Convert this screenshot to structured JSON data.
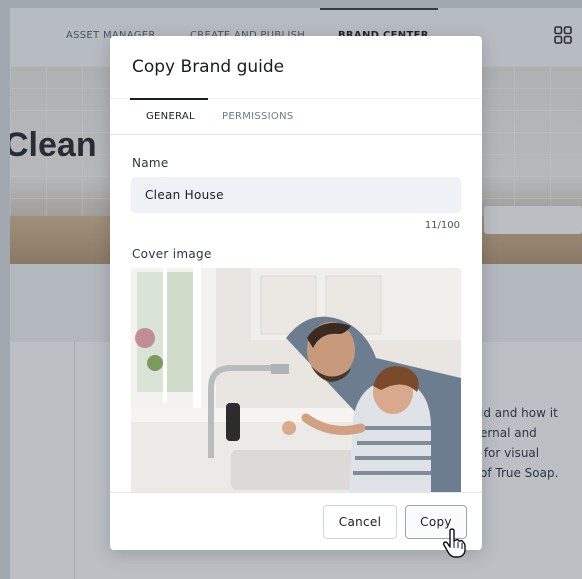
{
  "nav": {
    "items": [
      "ASSET MANAGER",
      "CREATE AND PUBLISH",
      "BRAND CENTER"
    ],
    "active_index": 2,
    "apps_icon": "grid-apps-icon"
  },
  "hero": {
    "title": "Clean"
  },
  "side_text": "id and how it\nernal and\n for visual\nof True Soap.",
  "modal": {
    "title": "Copy Brand guide",
    "tabs": [
      {
        "label": "GENERAL",
        "active": true
      },
      {
        "label": "PERMISSIONS",
        "active": false
      }
    ],
    "name_label": "Name",
    "name_value": "Clean House",
    "name_counter": "11/100",
    "cover_label": "Cover image",
    "cancel_label": "Cancel",
    "copy_label": "Copy",
    "cursor_icon": "hand-pointer-icon"
  },
  "colors": {
    "overlay": "#46505c",
    "input_bg": "#eef1f5",
    "tab_inactive": "#6b7a8b"
  }
}
